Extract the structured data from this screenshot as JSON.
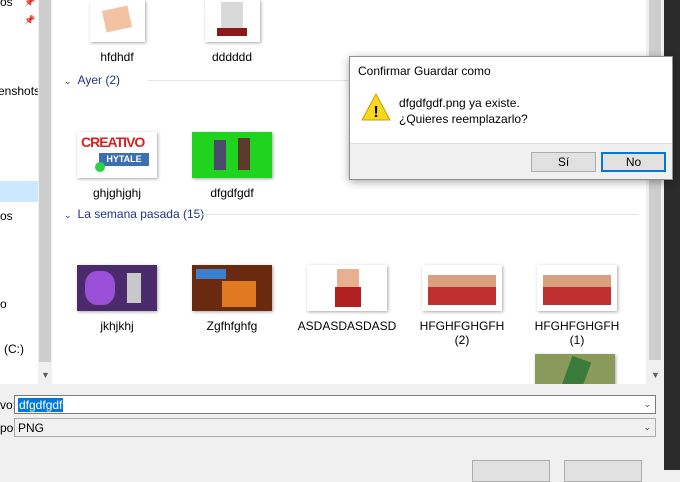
{
  "nav": {
    "items": [
      "os",
      "enshots",
      "os",
      "o",
      "(C:)"
    ]
  },
  "groups": [
    {
      "header": "Ayer (2)"
    },
    {
      "header": "La semana pasada (15)"
    }
  ],
  "top_files": [
    "hfdhdf",
    "dddddd"
  ],
  "yesterday_files": [
    "ghjghjghj",
    "dfgdfgdf"
  ],
  "lastweek_files": [
    "jkhjkhj",
    "Zgfhfghfg",
    "ASDASDASDASD",
    "HFGHFGHGFH\n(2)",
    "HFGHFGHGFH\n(1)"
  ],
  "thumb_texts": {
    "creativo": "CREATIVO",
    "hytale": "HYTALE"
  },
  "fields": {
    "filename_label": "vo:",
    "filename_value": "dfgdfgdf",
    "type_label": "po:",
    "type_value": "PNG"
  },
  "dialog": {
    "title": "Confirmar Guardar como",
    "line1": "dfgdfgdf.png ya existe.",
    "line2": "¿Quieres reemplazarlo?",
    "yes": "Sí",
    "no": "No",
    "warning_glyph": "!"
  },
  "colors": {
    "selection": "#0078d7",
    "group_header": "#1e3287",
    "warning": "#f9d71c"
  }
}
